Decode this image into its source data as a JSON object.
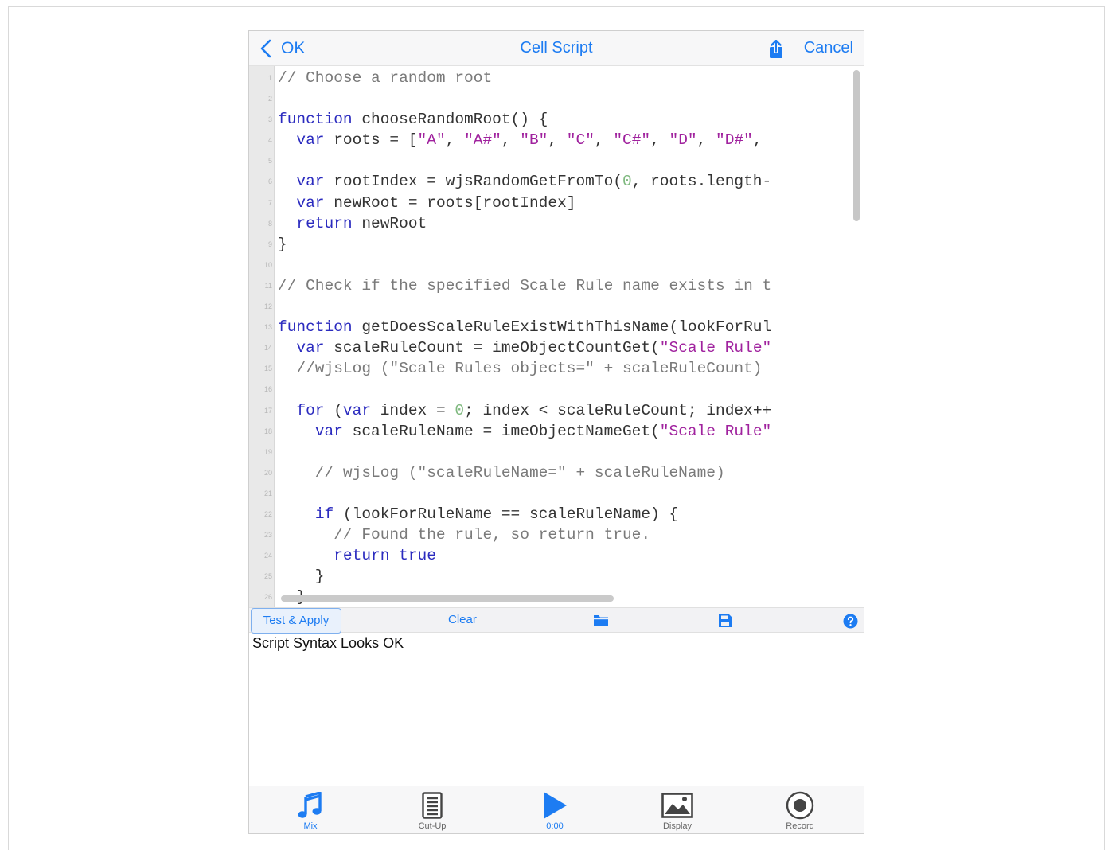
{
  "nav": {
    "ok_label": "OK",
    "title": "Cell Script",
    "cancel_label": "Cancel"
  },
  "code_lines": [
    [
      [
        "cm",
        "// Choose a random root"
      ]
    ],
    [],
    [
      [
        "kw",
        "function"
      ],
      [
        "tx",
        " chooseRandomRoot() {"
      ]
    ],
    [
      [
        "tx",
        "  "
      ],
      [
        "kw",
        "var"
      ],
      [
        "tx",
        " roots = ["
      ],
      [
        "str",
        "\"A\""
      ],
      [
        "tx",
        ", "
      ],
      [
        "str",
        "\"A#\""
      ],
      [
        "tx",
        ", "
      ],
      [
        "str",
        "\"B\""
      ],
      [
        "tx",
        ", "
      ],
      [
        "str",
        "\"C\""
      ],
      [
        "tx",
        ", "
      ],
      [
        "str",
        "\"C#\""
      ],
      [
        "tx",
        ", "
      ],
      [
        "str",
        "\"D\""
      ],
      [
        "tx",
        ", "
      ],
      [
        "str",
        "\"D#\""
      ],
      [
        "tx",
        ","
      ]
    ],
    [],
    [
      [
        "tx",
        "  "
      ],
      [
        "kw",
        "var"
      ],
      [
        "tx",
        " rootIndex = wjsRandomGetFromTo("
      ],
      [
        "num",
        "0"
      ],
      [
        "tx",
        ", roots.length-"
      ]
    ],
    [
      [
        "tx",
        "  "
      ],
      [
        "kw",
        "var"
      ],
      [
        "tx",
        " newRoot = roots[rootIndex]"
      ]
    ],
    [
      [
        "tx",
        "  "
      ],
      [
        "kw",
        "return"
      ],
      [
        "tx",
        " newRoot"
      ]
    ],
    [
      [
        "tx",
        "}"
      ]
    ],
    [],
    [
      [
        "cm",
        "// Check if the specified Scale Rule name exists in t"
      ]
    ],
    [],
    [
      [
        "kw",
        "function"
      ],
      [
        "tx",
        " getDoesScaleRuleExistWithThisName(lookForRul"
      ]
    ],
    [
      [
        "tx",
        "  "
      ],
      [
        "kw",
        "var"
      ],
      [
        "tx",
        " scaleRuleCount = imeObjectCountGet("
      ],
      [
        "str",
        "\"Scale Rule\""
      ]
    ],
    [
      [
        "cm",
        "  //wjsLog (\"Scale Rules objects=\" + scaleRuleCount)"
      ]
    ],
    [],
    [
      [
        "tx",
        "  "
      ],
      [
        "kw",
        "for"
      ],
      [
        "tx",
        " ("
      ],
      [
        "kw",
        "var"
      ],
      [
        "tx",
        " index = "
      ],
      [
        "num",
        "0"
      ],
      [
        "tx",
        "; index < scaleRuleCount; index++"
      ]
    ],
    [
      [
        "tx",
        "    "
      ],
      [
        "kw",
        "var"
      ],
      [
        "tx",
        " scaleRuleName = imeObjectNameGet("
      ],
      [
        "str",
        "\"Scale Rule\""
      ]
    ],
    [],
    [
      [
        "cm",
        "    // wjsLog (\"scaleRuleName=\" + scaleRuleName)"
      ]
    ],
    [],
    [
      [
        "tx",
        "    "
      ],
      [
        "kw",
        "if"
      ],
      [
        "tx",
        " (lookForRuleName == scaleRuleName) {"
      ]
    ],
    [
      [
        "cm",
        "      // Found the rule, so return true."
      ]
    ],
    [
      [
        "tx",
        "      "
      ],
      [
        "kw",
        "return"
      ],
      [
        "tx",
        " "
      ],
      [
        "kw",
        "true"
      ]
    ],
    [
      [
        "tx",
        "    }"
      ]
    ],
    [
      [
        "tx",
        "  }"
      ]
    ]
  ],
  "toolbar": {
    "test_apply_label": "Test & Apply",
    "clear_label": "Clear"
  },
  "output": {
    "message": "Script Syntax Looks OK"
  },
  "tabs": [
    {
      "label": "Mix",
      "icon": "music-note-icon",
      "active": true
    },
    {
      "label": "Cut-Up",
      "icon": "document-icon",
      "active": false
    },
    {
      "label": "0:00",
      "icon": "play-icon",
      "active": true
    },
    {
      "label": "Display",
      "icon": "picture-icon",
      "active": false
    },
    {
      "label": "Record",
      "icon": "record-icon",
      "active": false
    }
  ],
  "colors": {
    "accent": "#1d7cf2",
    "keyword": "#2b2bbf",
    "string": "#a0229e",
    "number": "#7fb97f",
    "comment": "#7a7a7a"
  }
}
